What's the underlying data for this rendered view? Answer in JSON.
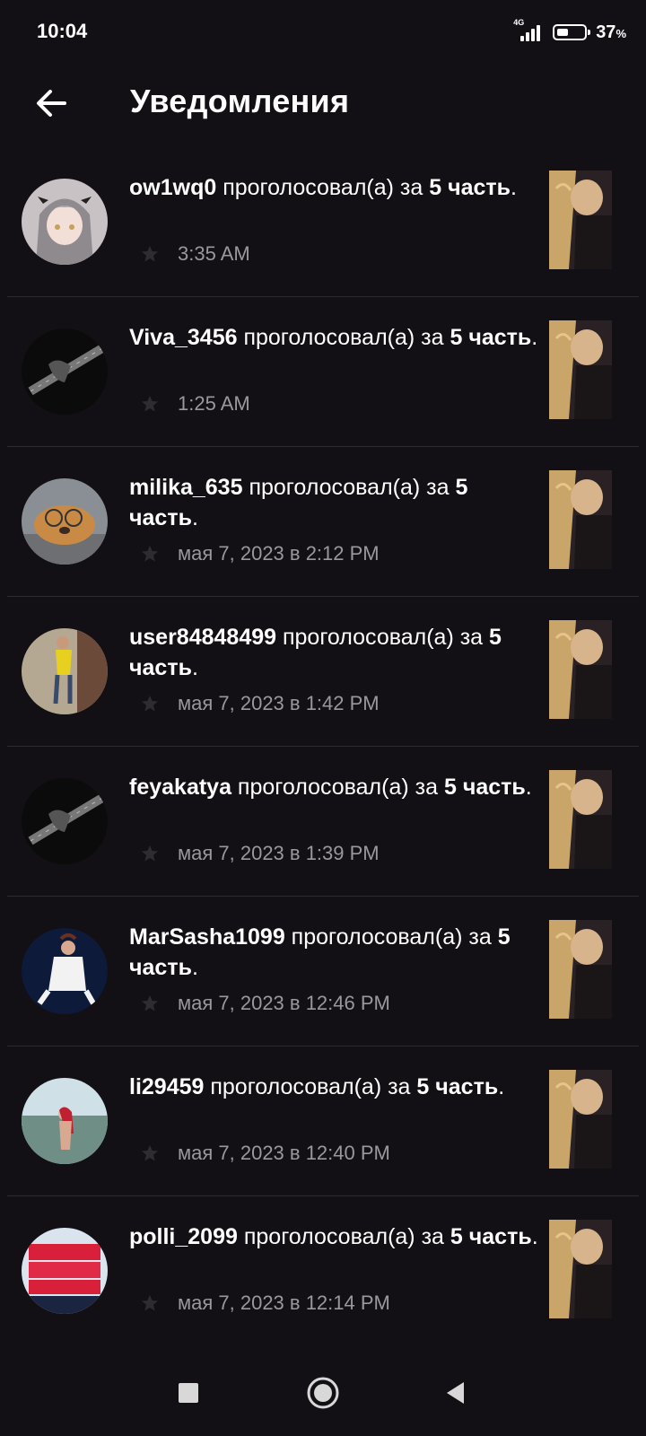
{
  "status": {
    "time": "10:04",
    "network": "4G",
    "battery_percent": "37",
    "battery_unit": "%"
  },
  "header": {
    "title": "Уведомления",
    "back_icon": "arrow-back-icon"
  },
  "notifications": [
    {
      "user": "ow1wq0",
      "action": " проголосовал(а) за ",
      "part_number": "5",
      "part_word": "часть",
      "tail": ".",
      "time": "3:35 AM"
    },
    {
      "user": "Viva_3456",
      "action": " проголосовал(а) за ",
      "part_number": "5",
      "part_word": "часть",
      "tail": ".",
      "time": "1:25 AM"
    },
    {
      "user": "milika_635",
      "action": " проголосовал(а) за ",
      "part_number": "5",
      "part_word": "часть",
      "tail": ".",
      "time": "мая 7, 2023 в 2:12 PM"
    },
    {
      "user": "user84848499",
      "action": " проголосовал(а) за ",
      "part_number": "5",
      "part_word": "часть",
      "tail": ".",
      "time": "мая 7, 2023 в 1:42 PM"
    },
    {
      "user": "feyakatya",
      "action": " проголосовал(а) за ",
      "part_number": "5",
      "part_word": "часть",
      "tail": ".",
      "time": "мая 7, 2023 в 1:39 PM"
    },
    {
      "user": "MarSasha1099",
      "action": " проголосовал(а) за ",
      "part_number": "5",
      "part_word": "часть",
      "tail": ".",
      "time": "мая 7, 2023 в 12:46 PM"
    },
    {
      "user": "li29459",
      "action": " проголосовал(а) за ",
      "part_number": "5",
      "part_word": "часть",
      "tail": ".",
      "time": "мая 7, 2023 в 12:40 PM"
    },
    {
      "user": "polli_2099",
      "action": " проголосовал(а) за ",
      "part_number": "5",
      "part_word": "часть",
      "tail": ".",
      "time": "мая 7, 2023 в 12:14 PM"
    }
  ],
  "nav": {
    "recents_icon": "square-icon",
    "home_icon": "circle-icon",
    "back_icon": "triangle-back-icon"
  },
  "colors": {
    "background": "#121014",
    "divider": "#2c2a2f",
    "muted_text": "#9a989c"
  }
}
